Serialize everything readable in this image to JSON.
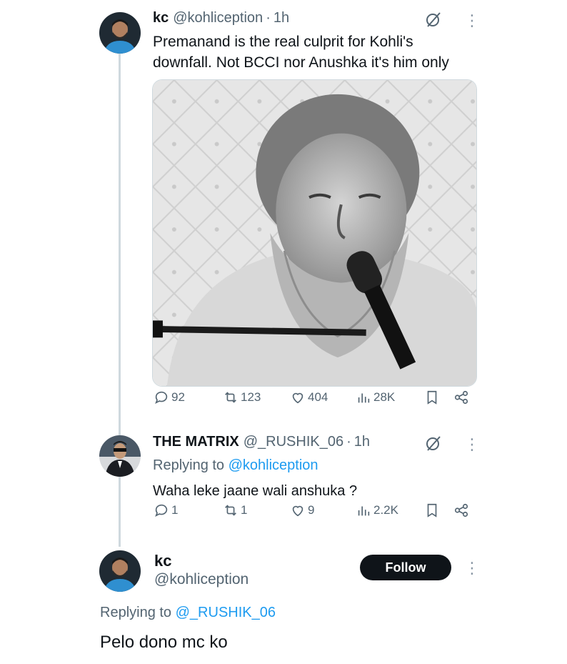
{
  "tweet1": {
    "name": "kc",
    "handle": "@kohliception",
    "separator": "·",
    "time": "1h",
    "text_line1": "Premanand is the real culprit for Kohli's",
    "text_line2": "downfall. Not BCCI nor Anushka it's him only",
    "image_icon": "photo-of-bearded-man-speaking-into-microphone",
    "stats": {
      "replies": "92",
      "retweets": "123",
      "likes": "404",
      "views": "28K"
    }
  },
  "tweet2": {
    "name": "THE MATRIX",
    "handle": "@_RUSHIK_06",
    "separator": "·",
    "time": "1h",
    "replying_prefix": "Replying to",
    "replying_handle": "@kohliception",
    "text": "Waha leke  jaane wali anshuka ?",
    "stats": {
      "replies": "1",
      "retweets": "1",
      "likes": "9",
      "views": "2.2K"
    }
  },
  "main_tweet": {
    "name": "kc",
    "handle": "@kohliception",
    "follow_label": "Follow",
    "replying_prefix": "Replying to",
    "replying_handle": "@_RUSHIK_06",
    "text": "Pelo dono mc ko"
  },
  "colors": {
    "text": "#0f1419",
    "muted": "#536471",
    "link": "#1d9bf0",
    "thread_line": "#cfd9de",
    "follow_bg": "#0f1419"
  },
  "more_glyph": "⋮"
}
